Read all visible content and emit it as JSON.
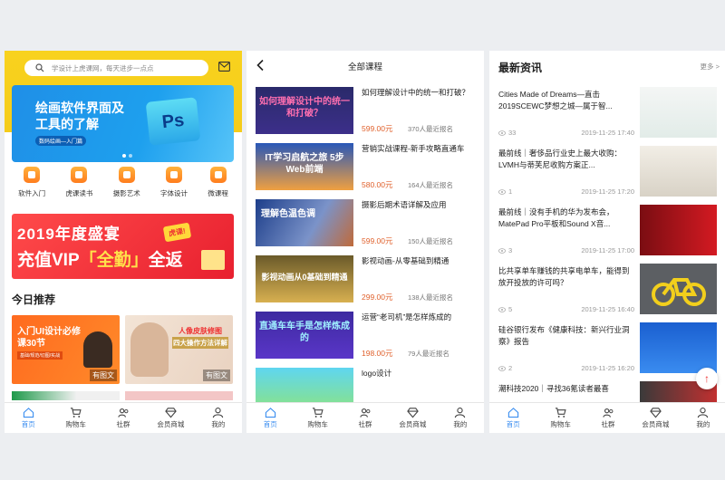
{
  "colors": {
    "accent_yellow": "#f8d21e",
    "tab_active": "#3b8ef0",
    "price": "#e0612c",
    "vip_red": "#e8202f"
  },
  "tabbar": {
    "home": "首页",
    "cart": "购物车",
    "community": "社群",
    "mall": "会员商城",
    "mine": "我的"
  },
  "home": {
    "search_placeholder": "学设计上虎课网，每天进步一点点",
    "banner": {
      "title": "绘画软件界面及工具的了解",
      "subtitle": "数码绘画—入门篇",
      "ps_text": "Ps"
    },
    "categories": [
      {
        "label": "软件入门",
        "icon": "software-icon"
      },
      {
        "label": "虎课读书",
        "icon": "book-icon"
      },
      {
        "label": "摄影艺术",
        "icon": "camera-icon"
      },
      {
        "label": "字体设计",
        "icon": "font-icon"
      },
      {
        "label": "微课程",
        "icon": "video-icon"
      }
    ],
    "vip": {
      "line1": "2019年度盛宴",
      "line2a": "充值VIP",
      "line2b": "「全勤」",
      "line2c": "全返",
      "badge": "虎课!"
    },
    "section_title": "今日推荐",
    "recommendations": [
      {
        "title": "入门UI设计必修课30节",
        "tag": "基础/规范/切图/实战",
        "has_image": "有图文"
      },
      {
        "title": "人像皮肤修图",
        "subtitle": "四大操作方法详解",
        "has_image": "有图文"
      }
    ]
  },
  "courses": {
    "title": "全部课程",
    "items": [
      {
        "thumb_text": "如何理解设计中的统一和打破？",
        "title": "如何理解设计中的统一和打破？",
        "price": "599.00元",
        "enrolled": "370人最近报名"
      },
      {
        "thumb_text": "IT学习启航之旅 5步 Web前端",
        "title": "营销实战课程-新手攻略直通车",
        "price": "580.00元",
        "enrolled": "164人最近报名"
      },
      {
        "thumb_text": "理解色温色调",
        "title": "摄影后期术语详解及应用",
        "price": "599.00元",
        "enrolled": "150人最近报名"
      },
      {
        "thumb_text": "影视动画从0基础到精通",
        "title": "影视动画-从零基础到精通",
        "price": "299.00元",
        "enrolled": "138人最近报名"
      },
      {
        "thumb_text": "直通车车手是怎样炼成的",
        "title": "运营“老司机”是怎样炼成的",
        "price": "198.00元",
        "enrolled": "79人最近报名"
      },
      {
        "thumb_text": "",
        "title": "logo设计",
        "price": "",
        "enrolled": ""
      }
    ]
  },
  "news": {
    "title": "最新资讯",
    "more": "更多 >",
    "items": [
      {
        "title": "Cities Made of Dreams—直击2019SCEWC梦想之城—属于智...",
        "views": "33",
        "time": "2019-11-25 17:40"
      },
      {
        "title": "最前线｜奢侈品行业史上最大收购：LVMH与蒂芙尼收购方案正...",
        "views": "1",
        "time": "2019-11-25 17:20"
      },
      {
        "title": "最前线｜没有手机的华为发布会，MatePad Pro平板和Sound X音...",
        "views": "3",
        "time": "2019-11-25 17:00"
      },
      {
        "title": "比共享单车赚钱的共享电单车，能得到放开投放的许可吗？",
        "views": "5",
        "time": "2019-11-25 16:40"
      },
      {
        "title": "硅谷银行发布《健康科技：新兴行业洞察》报告",
        "views": "2",
        "time": "2019-11-25 16:20"
      },
      {
        "title": "潮科技2020｜寻找36氪读者最喜",
        "views": "",
        "time": ""
      }
    ]
  }
}
